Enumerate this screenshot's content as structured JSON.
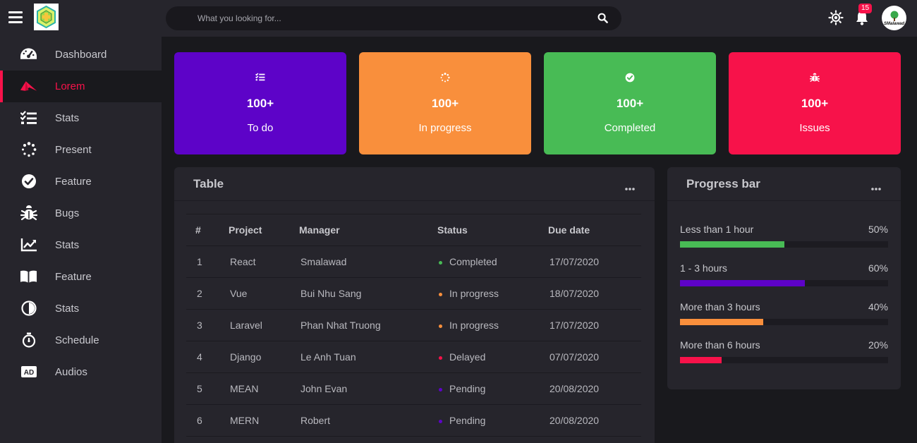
{
  "header": {
    "search_placeholder": "What you looking for...",
    "notification_count": "15",
    "avatar_name": "SMalawad"
  },
  "sidebar": {
    "items": [
      {
        "label": "Dashboard",
        "icon": "dashboard-icon"
      },
      {
        "label": "Lorem",
        "icon": "lorem-icon",
        "active": true
      },
      {
        "label": "Stats",
        "icon": "list-check-icon"
      },
      {
        "label": "Present",
        "icon": "spinner-icon"
      },
      {
        "label": "Feature",
        "icon": "check-circle-icon"
      },
      {
        "label": "Bugs",
        "icon": "bug-icon"
      },
      {
        "label": "Stats",
        "icon": "chart-line-icon"
      },
      {
        "label": "Feature",
        "icon": "book-icon"
      },
      {
        "label": "Stats",
        "icon": "adjust-icon"
      },
      {
        "label": "Schedule",
        "icon": "stopwatch-icon"
      },
      {
        "label": "Audios",
        "icon": "ad-icon"
      }
    ]
  },
  "cards": [
    {
      "value": "100+",
      "label": "To do",
      "color": "#5d03c8",
      "icon": "list-check-icon"
    },
    {
      "value": "100+",
      "label": "In progress",
      "color": "#f98f3c",
      "icon": "spinner-icon"
    },
    {
      "value": "100+",
      "label": "Completed",
      "color": "#48bb55",
      "icon": "check-circle-icon"
    },
    {
      "value": "100+",
      "label": "Issues",
      "color": "#f7124a",
      "icon": "bug-icon"
    }
  ],
  "table": {
    "title": "Table",
    "columns": [
      "#",
      "Project",
      "Manager",
      "Status",
      "Due date"
    ],
    "rows": [
      {
        "no": "1",
        "project": "React",
        "manager": "Smalawad",
        "status": "Completed",
        "status_color": "#48bb55",
        "due": "17/07/2020"
      },
      {
        "no": "2",
        "project": "Vue",
        "manager": "Bui Nhu Sang",
        "status": "In progress",
        "status_color": "#f98f3c",
        "due": "18/07/2020"
      },
      {
        "no": "3",
        "project": "Laravel",
        "manager": "Phan Nhat Truong",
        "status": "In progress",
        "status_color": "#f98f3c",
        "due": "17/07/2020"
      },
      {
        "no": "4",
        "project": "Django",
        "manager": "Le Anh Tuan",
        "status": "Delayed",
        "status_color": "#f7124a",
        "due": "07/07/2020"
      },
      {
        "no": "5",
        "project": "MEAN",
        "manager": "John Evan",
        "status": "Pending",
        "status_color": "#5d03c8",
        "due": "20/08/2020"
      },
      {
        "no": "6",
        "project": "MERN",
        "manager": "Robert",
        "status": "Pending",
        "status_color": "#5d03c8",
        "due": "20/08/2020"
      }
    ]
  },
  "progress": {
    "title": "Progress bar",
    "bars": [
      {
        "label": "Less than 1 hour",
        "value": "50%",
        "fraction": 0.5,
        "color": "#48bb55"
      },
      {
        "label": "1 - 3 hours",
        "value": "60%",
        "fraction": 0.6,
        "color": "#5d03c8"
      },
      {
        "label": "More than 3 hours",
        "value": "40%",
        "fraction": 0.4,
        "color": "#f98f3c"
      },
      {
        "label": "More than 6 hours",
        "value": "20%",
        "fraction": 0.2,
        "color": "#f7124a"
      }
    ]
  }
}
